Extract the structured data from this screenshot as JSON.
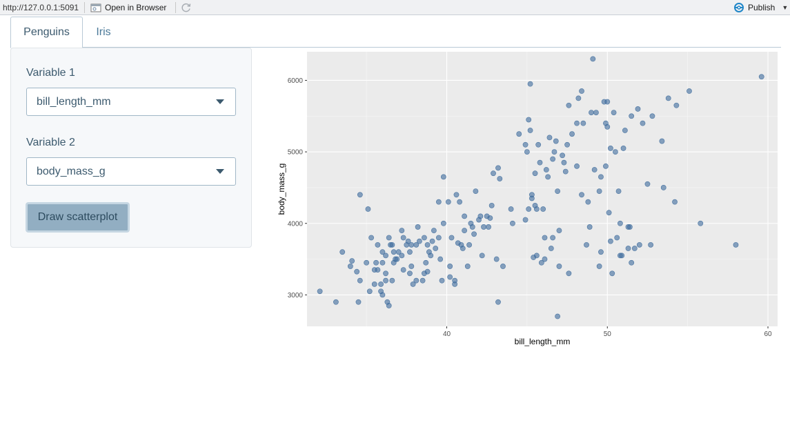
{
  "toolbar": {
    "url": "http://127.0.0.1:5091",
    "open_browser_label": "Open in Browser",
    "publish_label": "Publish",
    "accent": "#1f86c8"
  },
  "tabs": [
    {
      "label": "Penguins",
      "active": true
    },
    {
      "label": "Iris",
      "active": false
    }
  ],
  "sidebar": {
    "var1_label": "Variable 1",
    "var1_value": "bill_length_mm",
    "var2_label": "Variable 2",
    "var2_value": "body_mass_g",
    "button_label": "Draw scatterplot"
  },
  "chart_data": {
    "type": "scatter",
    "xlabel": "bill_length_mm",
    "ylabel": "body_mass_g",
    "xlim": [
      31.3,
      60.6
    ],
    "ylim": [
      2560,
      6400
    ],
    "xticks": [
      40,
      50,
      60
    ],
    "yticks": [
      3000,
      4000,
      5000,
      6000
    ],
    "grid": true,
    "point_color": "#3d6b9c",
    "background": "#ebebeb",
    "points": [
      [
        32.1,
        3050
      ],
      [
        33.1,
        2900
      ],
      [
        33.5,
        3600
      ],
      [
        34.0,
        3400
      ],
      [
        34.1,
        3475
      ],
      [
        34.4,
        3325
      ],
      [
        34.5,
        2900
      ],
      [
        34.6,
        3200
      ],
      [
        34.6,
        4400
      ],
      [
        35.0,
        3450
      ],
      [
        35.1,
        4200
      ],
      [
        35.2,
        3050
      ],
      [
        35.3,
        3800
      ],
      [
        35.5,
        3150
      ],
      [
        35.5,
        3350
      ],
      [
        35.6,
        3450
      ],
      [
        35.7,
        3700
      ],
      [
        35.7,
        3350
      ],
      [
        35.9,
        3150
      ],
      [
        35.9,
        3050
      ],
      [
        36.0,
        3600
      ],
      [
        36.0,
        3450
      ],
      [
        36.0,
        3000
      ],
      [
        36.2,
        3550
      ],
      [
        36.2,
        3200
      ],
      [
        36.2,
        3300
      ],
      [
        36.3,
        2900
      ],
      [
        36.4,
        3800
      ],
      [
        36.4,
        2850
      ],
      [
        36.5,
        3700
      ],
      [
        36.6,
        3700
      ],
      [
        36.6,
        3200
      ],
      [
        36.7,
        3600
      ],
      [
        36.7,
        3450
      ],
      [
        36.8,
        3500
      ],
      [
        36.9,
        3500
      ],
      [
        37.0,
        3600
      ],
      [
        37.2,
        3900
      ],
      [
        37.2,
        3550
      ],
      [
        37.3,
        3350
      ],
      [
        37.3,
        3800
      ],
      [
        37.5,
        3700
      ],
      [
        37.6,
        3750
      ],
      [
        37.7,
        3600
      ],
      [
        37.7,
        3300
      ],
      [
        37.8,
        3700
      ],
      [
        37.8,
        3400
      ],
      [
        37.9,
        3150
      ],
      [
        38.1,
        3200
      ],
      [
        38.1,
        3700
      ],
      [
        38.2,
        3950
      ],
      [
        38.3,
        3750
      ],
      [
        38.5,
        3200
      ],
      [
        38.6,
        3800
      ],
      [
        38.6,
        3300
      ],
      [
        38.7,
        3450
      ],
      [
        38.8,
        3700
      ],
      [
        38.8,
        3325
      ],
      [
        38.9,
        3600
      ],
      [
        39.0,
        3550
      ],
      [
        39.1,
        3750
      ],
      [
        39.2,
        3900
      ],
      [
        39.3,
        3650
      ],
      [
        39.5,
        3800
      ],
      [
        39.5,
        4300
      ],
      [
        39.6,
        3500
      ],
      [
        39.7,
        3200
      ],
      [
        39.8,
        4650
      ],
      [
        39.8,
        4000
      ],
      [
        40.1,
        4300
      ],
      [
        40.2,
        3400
      ],
      [
        40.3,
        3800
      ],
      [
        40.5,
        3200
      ],
      [
        40.6,
        4400
      ],
      [
        40.7,
        3725
      ],
      [
        40.8,
        4300
      ],
      [
        40.9,
        3700
      ],
      [
        41.0,
        3650
      ],
      [
        41.1,
        4100
      ],
      [
        41.3,
        3400
      ],
      [
        41.4,
        3700
      ],
      [
        41.5,
        4000
      ],
      [
        41.6,
        3950
      ],
      [
        41.7,
        3850
      ],
      [
        41.8,
        4450
      ],
      [
        42.0,
        4050
      ],
      [
        42.1,
        4100
      ],
      [
        42.2,
        3550
      ],
      [
        42.3,
        3950
      ],
      [
        42.5,
        4100
      ],
      [
        42.7,
        4075
      ],
      [
        42.8,
        4250
      ],
      [
        42.9,
        4700
      ],
      [
        43.1,
        3500
      ],
      [
        43.2,
        4775
      ],
      [
        43.3,
        4625
      ],
      [
        43.5,
        3400
      ],
      [
        44.0,
        4200
      ],
      [
        44.1,
        4000
      ],
      [
        44.5,
        5250
      ],
      [
        45.0,
        5000
      ],
      [
        45.1,
        5450
      ],
      [
        45.2,
        5950
      ],
      [
        45.3,
        4350
      ],
      [
        45.4,
        3525
      ],
      [
        45.5,
        4700
      ],
      [
        45.6,
        3550
      ],
      [
        45.7,
        5100
      ],
      [
        45.8,
        4850
      ],
      [
        46.0,
        4200
      ],
      [
        46.1,
        3500
      ],
      [
        46.2,
        4750
      ],
      [
        46.4,
        5200
      ],
      [
        46.5,
        3650
      ],
      [
        46.6,
        4900
      ],
      [
        46.8,
        5150
      ],
      [
        47.0,
        3900
      ],
      [
        47.2,
        4950
      ],
      [
        47.5,
        5100
      ],
      [
        47.6,
        5650
      ],
      [
        47.8,
        5250
      ],
      [
        48.1,
        5400
      ],
      [
        48.2,
        5750
      ],
      [
        48.4,
        4400
      ],
      [
        48.5,
        5400
      ],
      [
        48.7,
        3700
      ],
      [
        48.8,
        4300
      ],
      [
        49.0,
        5550
      ],
      [
        49.1,
        6300
      ],
      [
        49.2,
        4750
      ],
      [
        49.3,
        5550
      ],
      [
        49.5,
        4450
      ],
      [
        49.6,
        3600
      ],
      [
        49.8,
        5700
      ],
      [
        50.0,
        5700
      ],
      [
        50.1,
        4150
      ],
      [
        50.2,
        5050
      ],
      [
        50.4,
        5550
      ],
      [
        50.5,
        5000
      ],
      [
        50.6,
        3800
      ],
      [
        50.7,
        4450
      ],
      [
        50.8,
        4000
      ],
      [
        51.0,
        5050
      ],
      [
        51.1,
        5300
      ],
      [
        51.3,
        3650
      ],
      [
        51.5,
        3450
      ],
      [
        51.7,
        3650
      ],
      [
        52.0,
        3700
      ],
      [
        52.2,
        5400
      ],
      [
        52.5,
        4550
      ],
      [
        53.4,
        5150
      ],
      [
        53.5,
        4500
      ],
      [
        54.2,
        4300
      ],
      [
        55.1,
        5850
      ],
      [
        55.8,
        4000
      ],
      [
        58.0,
        3700
      ],
      [
        59.6,
        6050
      ],
      [
        46.9,
        2700
      ],
      [
        43.2,
        2900
      ],
      [
        42.6,
        3950
      ],
      [
        44.9,
        5100
      ],
      [
        45.2,
        5300
      ],
      [
        46.7,
        5000
      ],
      [
        47.3,
        4850
      ],
      [
        48.4,
        5850
      ],
      [
        49.9,
        5400
      ],
      [
        50.0,
        5350
      ],
      [
        51.5,
        5500
      ],
      [
        51.9,
        5600
      ],
      [
        52.8,
        5500
      ],
      [
        53.8,
        5750
      ],
      [
        54.3,
        5650
      ],
      [
        45.3,
        4400
      ],
      [
        45.5,
        4250
      ],
      [
        46.3,
        4650
      ],
      [
        46.9,
        4450
      ],
      [
        47.4,
        4725
      ],
      [
        48.1,
        4800
      ],
      [
        49.6,
        4650
      ],
      [
        49.9,
        4800
      ],
      [
        45.1,
        4200
      ],
      [
        45.6,
        4200
      ],
      [
        44.9,
        4050
      ],
      [
        46.6,
        3800
      ],
      [
        47.0,
        3400
      ],
      [
        47.6,
        3300
      ],
      [
        48.9,
        3950
      ],
      [
        50.3,
        3300
      ],
      [
        50.9,
        3550
      ],
      [
        51.4,
        3950
      ],
      [
        52.7,
        3700
      ],
      [
        45.9,
        3450
      ],
      [
        46.1,
        3800
      ],
      [
        49.5,
        3400
      ],
      [
        50.2,
        3750
      ],
      [
        50.8,
        3550
      ],
      [
        51.3,
        3950
      ],
      [
        40.2,
        3250
      ],
      [
        40.5,
        3150
      ],
      [
        41.1,
        3900
      ]
    ]
  }
}
